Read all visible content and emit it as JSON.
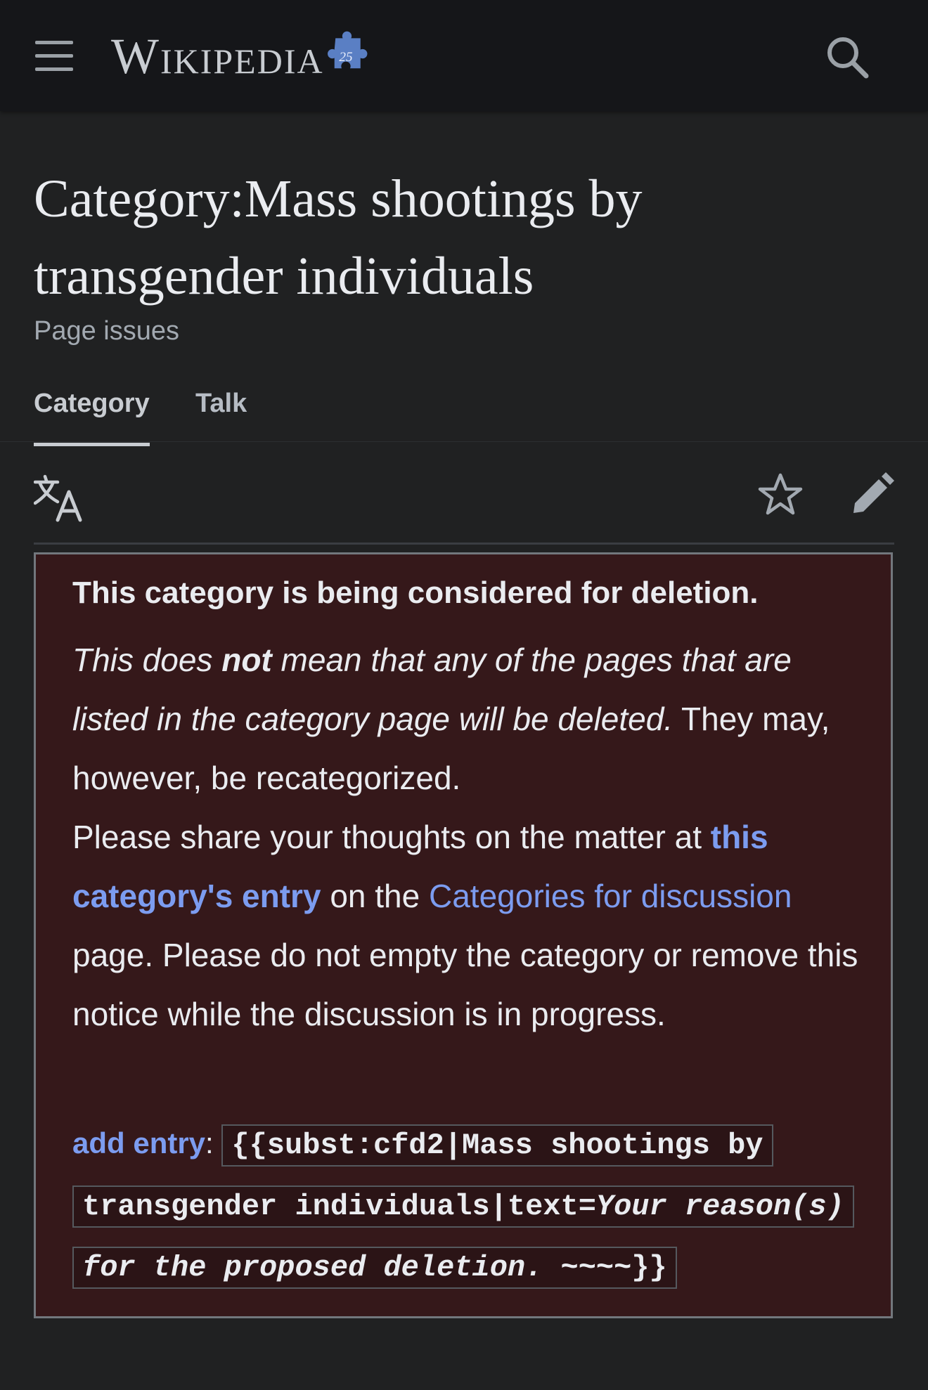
{
  "header": {
    "wordmark": "Wikipedia",
    "badge_number": "25",
    "menu_icon": "hamburger-menu-icon",
    "search_icon": "search-icon",
    "background": "#151619"
  },
  "page": {
    "title_line1": "Category:Mass shootings by",
    "title_line2": "transgender individuals",
    "page_issues": "Page issues"
  },
  "tabs": [
    {
      "label": "Category",
      "selected": true
    },
    {
      "label": "Talk",
      "selected": false
    }
  ],
  "toolbar": {
    "language_icon": "language-icon",
    "watch_icon": "star-icon",
    "edit_icon": "pencil-icon"
  },
  "notice": {
    "heading": "This category is being considered for deletion.",
    "italic_part1": "This does ",
    "italic_bold": "not",
    "italic_part2": " mean that any of the pages that are listed in the category page will be deleted.",
    "recategorized": " They may, however, be recategorized.",
    "share_prefix": "Please share your thoughts on the matter at ",
    "entry_link": "this category's entry",
    "on_the": " on the ",
    "cfd_link": "Categories for discussion",
    "share_suffix": " page. Please do not empty the category or remove this notice while the discussion is in progress.",
    "add_entry_link": "add entry",
    "add_entry_colon": ": ",
    "code_plain": "{{subst:cfd2|Mass shootings by transgender individuals|text=",
    "code_italic": "Your reason(s) for the proposed deletion.",
    "code_end": " ~~~~}}",
    "background": "#35181a",
    "link_color": "#7c9cf0"
  }
}
